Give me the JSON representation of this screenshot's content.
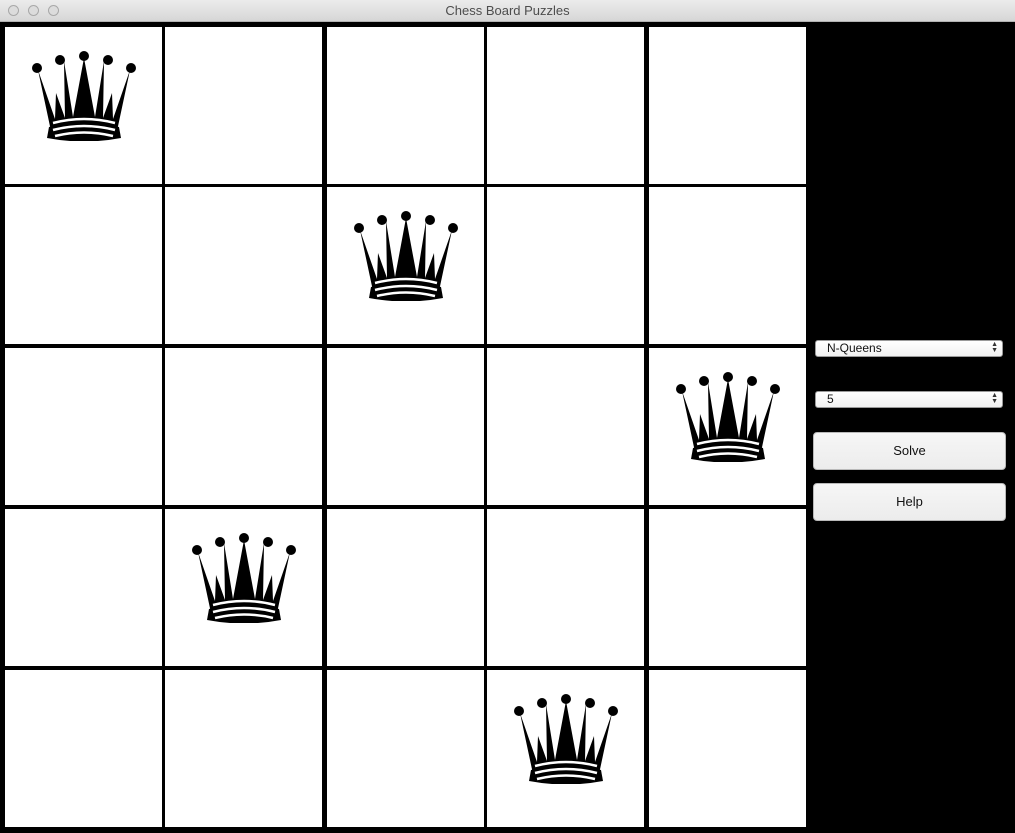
{
  "window": {
    "title": "Chess Board Puzzles"
  },
  "board": {
    "size": 5,
    "queen_positions": [
      [
        0,
        0
      ],
      [
        1,
        2
      ],
      [
        2,
        4
      ],
      [
        3,
        1
      ],
      [
        4,
        3
      ]
    ],
    "colors": {
      "light_square": "#ffffff",
      "grid_line": "#000000",
      "piece": "#000000"
    },
    "piece_icon": "queen-icon"
  },
  "controls": {
    "puzzle_select": {
      "value": "N-Queens"
    },
    "size_select": {
      "value": "5"
    },
    "solve_label": "Solve",
    "help_label": "Help"
  }
}
